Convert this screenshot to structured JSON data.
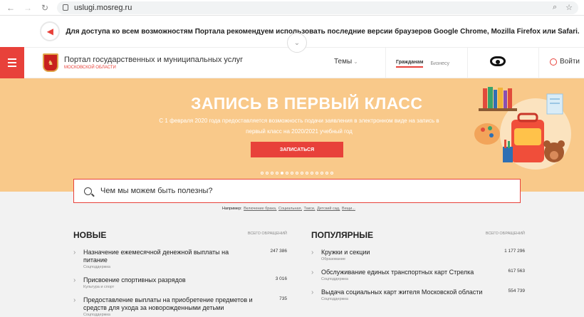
{
  "browser": {
    "url": "uslugi.mosreg.ru",
    "back": "←",
    "forward": "→",
    "reload": "↻",
    "search_icon": "⌕",
    "star_icon": "☆"
  },
  "notice": {
    "icon": "📢",
    "text": "Для доступа ко всем возможностям Портала рекомендуем использовать последние версии браузеров Google Chrome, Mozilla Firefox или Safari.",
    "chevron": "⌄"
  },
  "header": {
    "portal_title": "Портал государственных и муниципальных услуг",
    "region": "МОСКОВСКОЙ ОБЛАСТИ",
    "topics": "Темы",
    "topics_caret": "⌄",
    "segment_citizens": "Гражданам",
    "segment_business": "Бизнесу",
    "login": "Войти"
  },
  "hero": {
    "title": "ЗАПИСЬ В ПЕРВЫЙ КЛАСС",
    "subtitle": "С 1 февраля 2020 года предоставляется возможность подачи заявления в электронном виде на запись в первый класс на 2020/2021 учебный год",
    "cta": "ЗАПИСАТЬСЯ",
    "slides_total": 15,
    "active_slide": 5
  },
  "search": {
    "placeholder": "Чем мы можем быть полезны?",
    "examples_label": "Например:",
    "examples": [
      "Включение брака,",
      "Социальная,",
      "Такси,",
      "Детский сад,",
      "Вещи..."
    ]
  },
  "new_services": {
    "title": "НОВЫЕ",
    "hint": "ВСЕГО ОБРАЩЕНИЙ",
    "items": [
      {
        "name": "Назначение ежемесячной денежной выплаты на питание",
        "category": "Соцподдержка",
        "count": "247 386"
      },
      {
        "name": "Присвоение спортивных разрядов",
        "category": "Культура и спорт",
        "count": "3 016"
      },
      {
        "name": "Предоставление выплаты на приобретение предметов и средств для ухода за новорожденными детьми",
        "category": "Соцподдержка",
        "count": "735"
      }
    ]
  },
  "popular_services": {
    "title": "ПОПУЛЯРНЫЕ",
    "hint": "ВСЕГО ОБРАЩЕНИЙ",
    "items": [
      {
        "name": "Кружки и секции",
        "category": "Образование",
        "count": "1 177 296"
      },
      {
        "name": "Обслуживание единых транспортных карт Стрелка",
        "category": "Соцподдержка",
        "count": "617 563"
      },
      {
        "name": "Выдача социальных карт жителя Московской области",
        "category": "Соцподдержка",
        "count": "554 739"
      }
    ]
  },
  "colors": {
    "accent": "#e8413a",
    "hero_bg": "#f9c98a"
  }
}
